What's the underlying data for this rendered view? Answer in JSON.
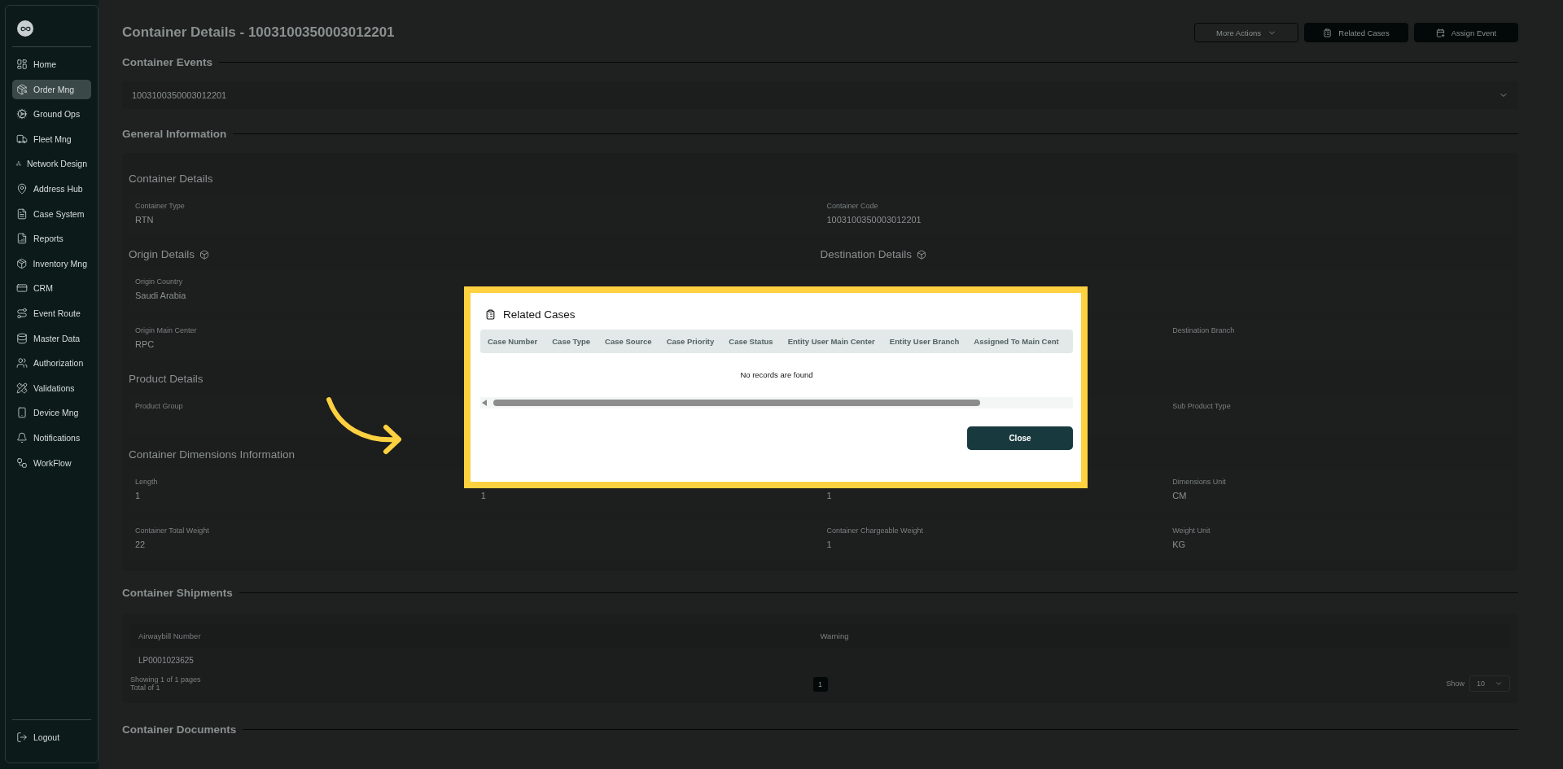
{
  "sidebar": {
    "items": [
      {
        "label": "Home",
        "selected": false
      },
      {
        "label": "Order Mng",
        "selected": true
      },
      {
        "label": "Ground Ops",
        "selected": false
      },
      {
        "label": "Fleet Mng",
        "selected": false
      },
      {
        "label": "Network Design",
        "selected": false
      },
      {
        "label": "Address Hub",
        "selected": false
      },
      {
        "label": "Case System",
        "selected": false
      },
      {
        "label": "Reports",
        "selected": false
      },
      {
        "label": "Inventory Mng",
        "selected": false
      },
      {
        "label": "CRM",
        "selected": false
      },
      {
        "label": "Event Route",
        "selected": false
      },
      {
        "label": "Master Data",
        "selected": false
      },
      {
        "label": "Authorization",
        "selected": false
      },
      {
        "label": "Validations",
        "selected": false
      },
      {
        "label": "Device Mng",
        "selected": false
      },
      {
        "label": "Notifications",
        "selected": false
      },
      {
        "label": "WorkFlow",
        "selected": false
      }
    ],
    "logout": "Logout"
  },
  "header": {
    "title": "Container Details - 1003100350003012201",
    "actions": [
      {
        "label": "More Actions",
        "kind": "dropdown"
      },
      {
        "label": "Related Cases",
        "kind": "solid"
      },
      {
        "label": "Assign Event",
        "kind": "solid"
      }
    ]
  },
  "container_events": {
    "heading": "Container Events",
    "value": "1003100350003012201"
  },
  "general_information": {
    "heading": "General Information",
    "groups": [
      {
        "titles": [
          "Container Details"
        ],
        "rows": [
          [
            {
              "label": "Container Type",
              "value": "RTN"
            },
            null,
            {
              "label": "Container Code",
              "value": "1003100350003012201"
            },
            null
          ]
        ]
      },
      {
        "titles": [
          "Origin Details",
          "Destination Details"
        ],
        "rows": [
          [
            {
              "label": "Origin Country",
              "value": "Saudi Arabia"
            },
            null,
            null,
            null
          ],
          [
            {
              "label": "Origin Main Center",
              "value": "RPC"
            },
            null,
            null,
            {
              "label": "Destination Branch"
            }
          ]
        ]
      },
      {
        "titles": [
          "Product Details"
        ],
        "rows": [
          [
            {
              "label": "Product Group"
            },
            null,
            null,
            {
              "label": "Sub Product Type"
            }
          ]
        ]
      },
      {
        "titles": [
          "Container Dimensions Information"
        ],
        "rows": [
          [
            {
              "label": "Length",
              "value": "1"
            },
            {
              "value": "1"
            },
            {
              "value": "1"
            },
            {
              "label": "Dimensions Unit",
              "value": "CM"
            }
          ],
          [
            {
              "label": "Container Total Weight",
              "value": "22"
            },
            null,
            {
              "label": "Container Chargeable Weight",
              "value": "1"
            },
            {
              "label": "Weight Unit",
              "value": "KG"
            }
          ]
        ]
      }
    ]
  },
  "container_shipments": {
    "heading": "Container Shipments",
    "columns": [
      "Airwaybill Number",
      "Warning"
    ],
    "rows": [
      [
        "LP0001023625"
      ]
    ],
    "pagination": {
      "summary": "Showing 1 of 1 pages",
      "total": "Total of 1",
      "pages": [
        {
          "label": "1",
          "selected": true
        }
      ],
      "show_label": "Show",
      "page_size": "10"
    }
  },
  "container_documents": {
    "heading": "Container Documents"
  },
  "modal": {
    "title": "Related Cases",
    "columns": [
      "Case Number",
      "Case Type",
      "Case Source",
      "Case Priority",
      "Case Status",
      "Entity User Main Center",
      "Entity User Branch",
      "Assigned To Main Cent"
    ],
    "empty_text": "No records are found",
    "close": "Close"
  }
}
